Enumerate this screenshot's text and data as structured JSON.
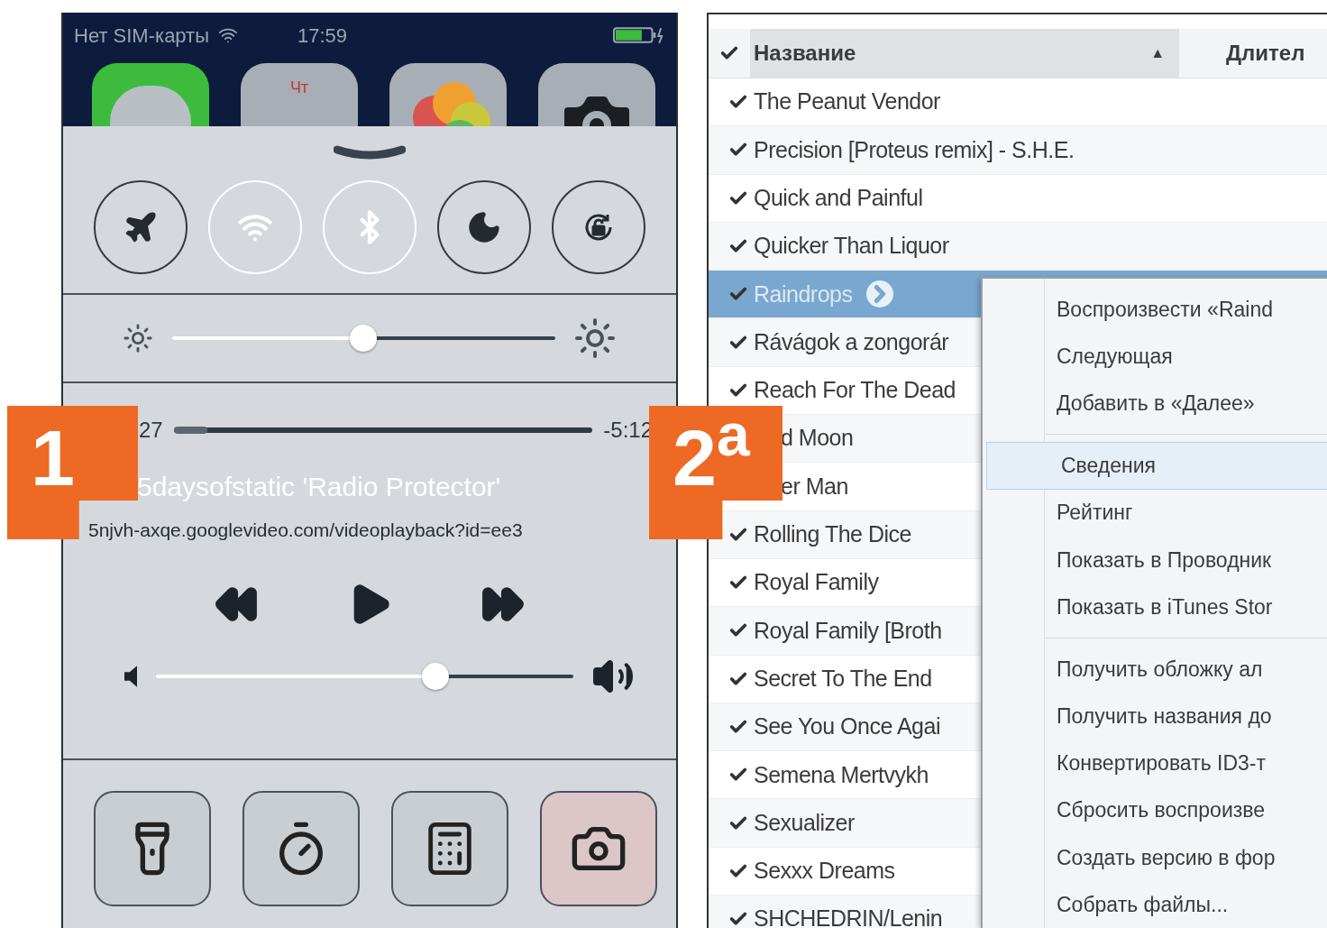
{
  "phone": {
    "badge": "1",
    "status_bar": {
      "carrier": "Нет SIM-карты",
      "time": "17:59"
    },
    "home_apps": [
      {
        "kind": "messages"
      },
      {
        "kind": "calendar",
        "weekday": "Чт"
      },
      {
        "kind": "photos"
      },
      {
        "kind": "camera"
      }
    ],
    "toggles": [
      {
        "kind": "airplane",
        "dimmed": false
      },
      {
        "kind": "wifi",
        "dimmed": true
      },
      {
        "kind": "bluetooth",
        "dimmed": true
      },
      {
        "kind": "moon",
        "dimmed": false
      },
      {
        "kind": "rotation-lock",
        "dimmed": false
      }
    ],
    "brightness": {
      "level": 0.5
    },
    "player": {
      "elapsed": "27",
      "remaining": "-5:12",
      "level": 0.08,
      "title": "5daysofstatic 'Radio Protector'",
      "subtitle": "5njvh-axqe.googlevideo.com/videoplayback?id=ee3"
    },
    "volume": {
      "level": 0.67
    },
    "shortcuts": [
      {
        "kind": "flashlight",
        "pressed": false
      },
      {
        "kind": "timer",
        "pressed": false
      },
      {
        "kind": "calculator",
        "pressed": false
      },
      {
        "kind": "camera",
        "pressed": true
      }
    ]
  },
  "itunes": {
    "badge": "2$^{а}$",
    "header": {
      "checked": true,
      "title": "Название",
      "sort": "▲",
      "column_2": "Длител"
    },
    "rows": [
      {
        "title": "The Peanut Vendor",
        "checked": true,
        "selected": false
      },
      {
        "title": "Precision [Proteus remix] - S.H.E.",
        "checked": true,
        "selected": false
      },
      {
        "title": "Quick and Painful",
        "checked": true,
        "selected": false
      },
      {
        "title": "Quicker Than Liquor",
        "checked": true,
        "selected": false
      },
      {
        "title": "Raindrops",
        "checked": true,
        "selected": true
      },
      {
        "title": "Rávágok a zongorár",
        "checked": true,
        "selected": false
      },
      {
        "title": "Reach For The Dead",
        "checked": true,
        "selected": false
      },
      {
        "title": "d Moon",
        "selected": false
      },
      {
        "title": "er Man",
        "selected": false
      },
      {
        "title": "Rolling The Dice",
        "checked": true,
        "selected": false
      },
      {
        "title": "Royal Family",
        "checked": true,
        "selected": false
      },
      {
        "title": "Royal Family [Broth",
        "checked": true,
        "selected": false
      },
      {
        "title": "Secret To The End",
        "checked": true,
        "selected": false
      },
      {
        "title": "See You Once Agai",
        "checked": true,
        "selected": false
      },
      {
        "title": "Semena Mertvykh",
        "checked": true,
        "selected": false
      },
      {
        "title": "Sexualizer",
        "checked": true,
        "selected": false
      },
      {
        "title": "Sexxx Dreams",
        "checked": true,
        "selected": false
      },
      {
        "title": "SHCHEDRIN/Lenin",
        "checked": true,
        "selected": false
      }
    ],
    "context_menu": [
      {
        "kind": "item",
        "label": "Воспроизвести «Raind",
        "highlighted": false
      },
      {
        "kind": "item",
        "label": "Следующая",
        "highlighted": false
      },
      {
        "kind": "item",
        "label": "Добавить в «Далее»",
        "highlighted": false
      },
      {
        "kind": "separator"
      },
      {
        "kind": "item",
        "label": "Сведения",
        "highlighted": true
      },
      {
        "kind": "item",
        "label": "Рейтинг",
        "highlighted": false
      },
      {
        "kind": "item",
        "label": "Показать в Проводник",
        "highlighted": false
      },
      {
        "kind": "item",
        "label": "Показать в iTunes Stor",
        "highlighted": false
      },
      {
        "kind": "separator"
      },
      {
        "kind": "item",
        "label": "Получить обложку ал",
        "highlighted": false
      },
      {
        "kind": "item",
        "label": "Получить названия до",
        "highlighted": false
      },
      {
        "kind": "item",
        "label": "Конвертировать ID3-т",
        "highlighted": false
      },
      {
        "kind": "item",
        "label": "Сбросить воспроизве",
        "highlighted": false
      },
      {
        "kind": "item",
        "label": "Создать версию в фор",
        "highlighted": false
      },
      {
        "kind": "item",
        "label": "Собрать файлы...",
        "highlighted": false
      }
    ]
  }
}
